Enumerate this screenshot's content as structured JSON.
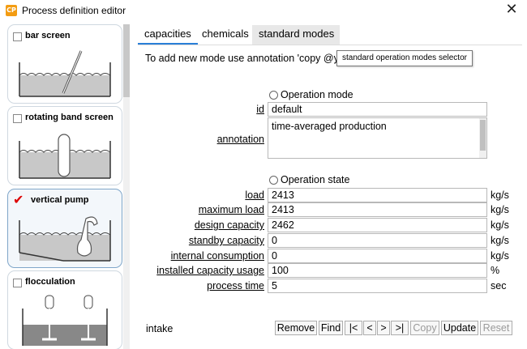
{
  "window": {
    "title": "Process definition editor",
    "app_icon_text": "CP"
  },
  "sidebar": {
    "items": [
      {
        "label": "bar screen",
        "checked": false
      },
      {
        "label": "rotating band screen",
        "checked": false
      },
      {
        "label": "vertical pump",
        "checked": true
      },
      {
        "label": "flocculation",
        "checked": false
      }
    ]
  },
  "tabs": [
    {
      "label": "capacities",
      "active": true
    },
    {
      "label": "chemicals",
      "active": false
    },
    {
      "label": "standard modes",
      "active": false
    }
  ],
  "info_text": "To add new mode use annotation 'copy @y",
  "tooltip": "standard operation modes selector",
  "operation_mode": {
    "radio_label": "Operation mode",
    "id_label": "id",
    "id_value": "default",
    "annotation_label": "annotation",
    "annotation_value": "time-averaged production"
  },
  "operation_state": {
    "radio_label": "Operation state",
    "fields": [
      {
        "label": "load",
        "value": "2413",
        "unit": "kg/s"
      },
      {
        "label": "maximum load",
        "value": "2413",
        "unit": "kg/s"
      },
      {
        "label": "design capacity",
        "value": "2462",
        "unit": "kg/s"
      },
      {
        "label": "standby capacity",
        "value": "0",
        "unit": "kg/s"
      },
      {
        "label": "internal consumption",
        "value": "0",
        "unit": "kg/s"
      },
      {
        "label": "installed capacity usage",
        "value": "100",
        "unit": "%"
      },
      {
        "label": "process time",
        "value": "5",
        "unit": "sec"
      }
    ]
  },
  "footer": {
    "status_text": "intake",
    "buttons": {
      "remove": "Remove",
      "find": "Find",
      "first": "|<",
      "prev": "<",
      "next": ">",
      "last": ">|",
      "copy": "Copy",
      "update": "Update",
      "reset": "Reset"
    }
  },
  "colors": {
    "accent": "#2a7fd8",
    "check": "#dd0000"
  }
}
